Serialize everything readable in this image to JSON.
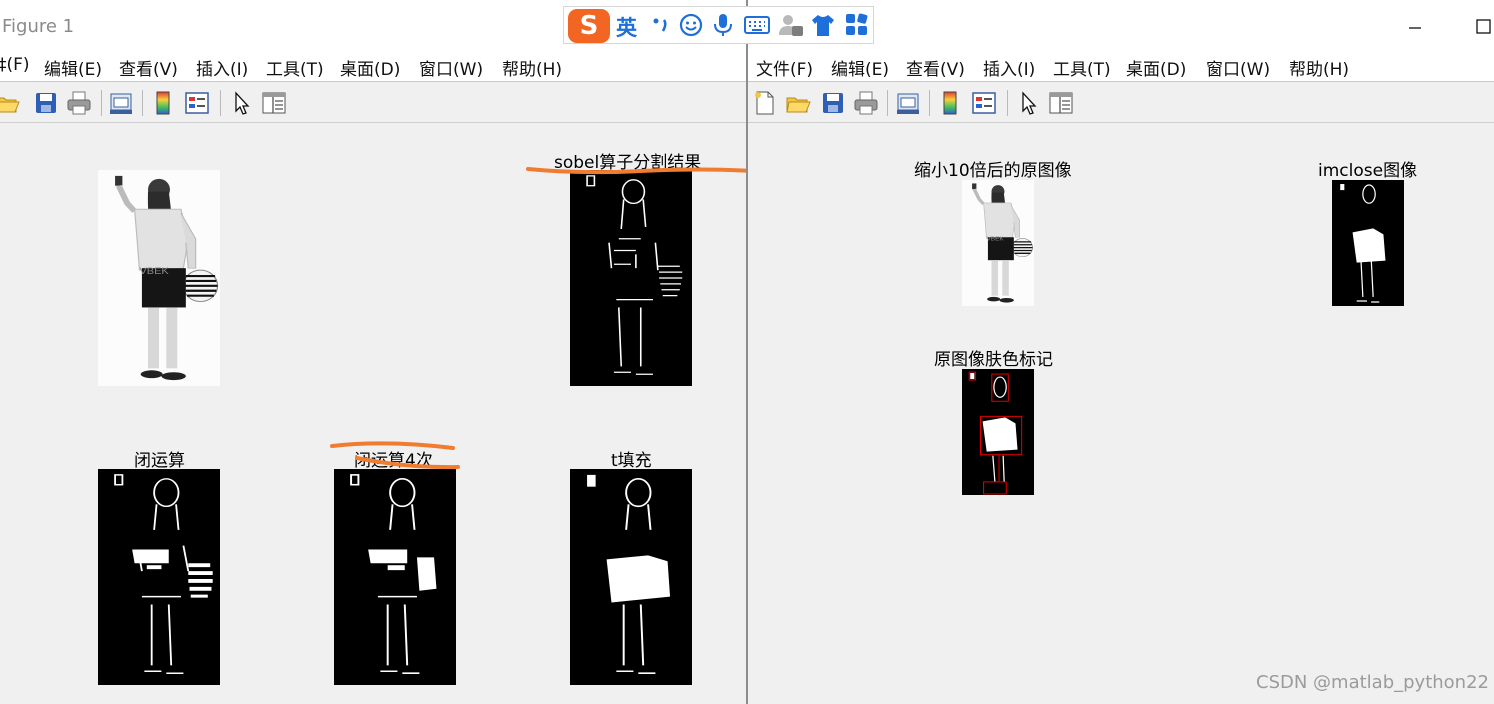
{
  "left_window": {
    "title": "Figure 1",
    "menu": [
      "‡(F)",
      "编辑(E)",
      "查看(V)",
      "插入(I)",
      "工具(T)",
      "桌面(D)",
      "窗口(W)",
      "帮助(H)"
    ],
    "toolbar_icons": [
      "open-folder-icon",
      "save-icon",
      "print-icon",
      "print-preview-icon",
      "colorbar-icon",
      "legend-icon",
      "pointer-icon",
      "property-editor-icon"
    ],
    "subplots": {
      "original": "",
      "sobel": "sobel算子分割结果",
      "close": "闭运算",
      "close4": "闭运算4次",
      "fill": "t填充"
    }
  },
  "right_window": {
    "menu": [
      "文件(F)",
      "编辑(E)",
      "查看(V)",
      "插入(I)",
      "工具(T)",
      "桌面(D)",
      "窗口(W)",
      "帮助(H)"
    ],
    "toolbar_icons": [
      "new-figure-icon",
      "open-folder-icon",
      "save-icon",
      "print-icon",
      "print-preview-icon",
      "colorbar-icon",
      "legend-icon",
      "pointer-icon",
      "property-editor-icon"
    ],
    "window_buttons": [
      "minimize",
      "maximize"
    ],
    "subplots": {
      "scaled": "缩小10倍后的原图像",
      "imclose": "imclose图像",
      "skin": "原图像肤色标记"
    }
  },
  "ime_bar": {
    "logo": "S",
    "language": "英",
    "icons": [
      "punctuation-icon",
      "emoji-icon",
      "microphone-icon",
      "keyboard-icon",
      "user-icon",
      "skin-icon",
      "toolbox-icon"
    ]
  },
  "watermark": "CSDN @matlab_python22",
  "colors": {
    "annotation": "#f07c30",
    "skin_mark": "#e00000"
  }
}
